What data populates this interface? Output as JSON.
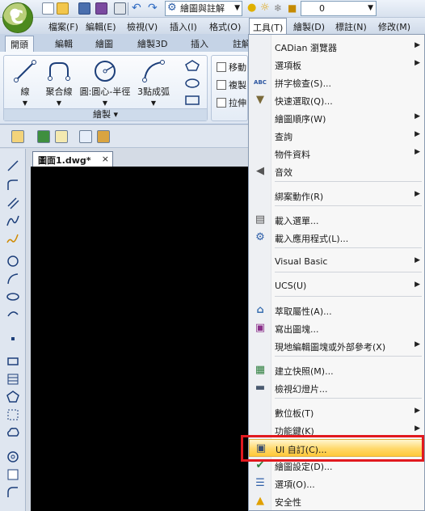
{
  "quick_access": {
    "workspace": "繪圖與註解",
    "layer": "0"
  },
  "menubar": {
    "items": [
      "檔案(F)",
      "編輯(E)",
      "檢視(V)",
      "插入(I)",
      "格式(O)",
      "工具(T)",
      "繪製(D)",
      "標註(N)",
      "修改(M)"
    ]
  },
  "ribbon_tabs": [
    "開頭",
    "編輯",
    "繪圖",
    "繪製3D",
    "插入",
    "註解"
  ],
  "ribbon": {
    "draw_group_label": "繪製",
    "buttons": [
      "線",
      "聚合線",
      "圓:圓心-半徑",
      "3點成弧"
    ],
    "small_buttons": [
      "移動",
      "複製",
      "拉伸"
    ]
  },
  "document": {
    "tab_title": "圖面1.dwg*",
    "close_glyph": "×"
  },
  "tools_menu": {
    "items": [
      {
        "label": "CADian 瀏覽器",
        "icon": "",
        "submenu": true
      },
      {
        "label": "選項板",
        "icon": "",
        "submenu": true
      },
      {
        "label": "拼字檢查(S)...",
        "icon": "spellcheck-icon",
        "submenu": false
      },
      {
        "label": "快速選取(Q)...",
        "icon": "filter-icon",
        "submenu": false
      },
      {
        "label": "繪圖順序(W)",
        "icon": "",
        "submenu": true
      },
      {
        "label": "查詢",
        "icon": "",
        "submenu": true
      },
      {
        "label": "物件資料",
        "icon": "",
        "submenu": true
      },
      {
        "label": "音效",
        "icon": "speaker-icon",
        "submenu": false
      },
      {
        "label": "綁案動作(R)",
        "icon": "",
        "submenu": true
      },
      {
        "label": "載入選單...",
        "icon": "menu-load-icon",
        "submenu": false
      },
      {
        "label": "載入應用程式(L)...",
        "icon": "app-load-icon",
        "submenu": false
      },
      {
        "label": "Visual Basic",
        "icon": "",
        "submenu": true
      },
      {
        "label": "UCS(U)",
        "icon": "",
        "submenu": true
      },
      {
        "label": "萃取屬性(A)...",
        "icon": "extract-icon",
        "submenu": false
      },
      {
        "label": "寫出圖塊...",
        "icon": "wblock-icon",
        "submenu": false
      },
      {
        "label": "現地編輯圖塊或外部參考(X)",
        "icon": "",
        "submenu": true
      },
      {
        "label": "建立快照(M)...",
        "icon": "snapshot-icon",
        "submenu": false
      },
      {
        "label": "檢視幻燈片...",
        "icon": "slide-icon",
        "submenu": false
      },
      {
        "label": "數位板(T)",
        "icon": "",
        "submenu": true
      },
      {
        "label": "功能鍵(K)",
        "icon": "",
        "submenu": true
      },
      {
        "label": "UI 自訂(C)...",
        "icon": "ui-customize-icon",
        "submenu": false,
        "highlighted": true
      },
      {
        "label": "繪圖設定(D)...",
        "icon": "settings-icon",
        "submenu": false
      },
      {
        "label": "選項(O)...",
        "icon": "options-icon",
        "submenu": false
      },
      {
        "label": "安全性",
        "icon": "warning-icon",
        "submenu": false
      }
    ],
    "submenu_arrow": "▶"
  },
  "colors": {
    "highlight": "#ffd86a",
    "callout": "#e1191f",
    "canvas": "#000000"
  }
}
